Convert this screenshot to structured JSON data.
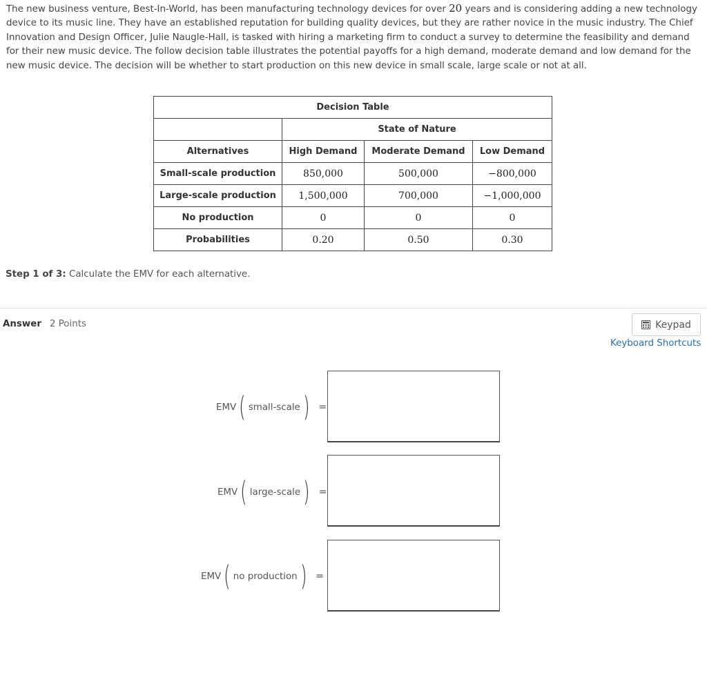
{
  "intro": {
    "part1": "The new business venture, Best-In-World, has been manufacturing technology devices for over ",
    "years": "20",
    "part2": " years and is considering adding a new technology device to its music line. They have an established reputation for building quality devices, but they are rather novice in the music industry. The Chief Innovation and Design Officer, Julie Naugle-Hall, is tasked with hiring a marketing firm to conduct a survey to determine the feasibility and demand for their new music device. The follow decision table illustrates the potential payoffs for a high demand, moderate demand and low demand for the new music device. The decision will be whether to start production on this new device in small scale, large scale or not at all."
  },
  "table": {
    "title": "Decision Table",
    "state_header": "State of Nature",
    "columns": [
      "Alternatives",
      "High Demand",
      "Moderate Demand",
      "Low Demand"
    ],
    "rows": [
      {
        "label": "Small-scale production",
        "values": [
          "850,000",
          "500,000",
          "−800,000"
        ]
      },
      {
        "label": "Large-scale production",
        "values": [
          "1,500,000",
          "700,000",
          "−1,000,000"
        ]
      },
      {
        "label": "No production",
        "values": [
          "0",
          "0",
          "0"
        ]
      },
      {
        "label": "Probabilities",
        "values": [
          "0.20",
          "0.50",
          "0.30"
        ]
      }
    ]
  },
  "step": {
    "prefix": "Step 1 of 3:",
    "text": " Calculate the EMV for each alternative."
  },
  "answer": {
    "label": "Answer",
    "points": "2 Points"
  },
  "keypad": {
    "label": "Keypad",
    "icon": "calculator-icon"
  },
  "keyboard_shortcuts": "Keyboard Shortcuts",
  "emv": [
    {
      "fn": "EMV",
      "arg": "small-scale",
      "eq": "=",
      "currency": "$",
      "value": ""
    },
    {
      "fn": "EMV",
      "arg": "large-scale",
      "eq": "=",
      "currency": "$",
      "value": ""
    },
    {
      "fn": "EMV",
      "arg": "no production",
      "eq": "=",
      "currency": "$",
      "value": ""
    }
  ]
}
